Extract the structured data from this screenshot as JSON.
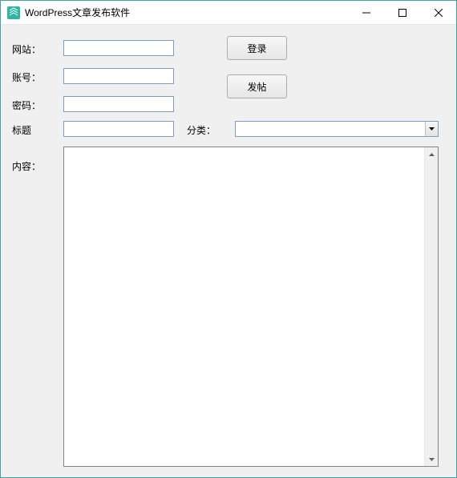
{
  "window": {
    "title": "WordPress文章发布软件"
  },
  "labels": {
    "website": "网站：",
    "account": "账号：",
    "password": "密码：",
    "title": "标题",
    "category": "分类：",
    "content": "内容："
  },
  "buttons": {
    "login": "登录",
    "post": "发帖"
  },
  "fields": {
    "website": "",
    "account": "",
    "password": "",
    "title": "",
    "category_selected": "",
    "content": ""
  }
}
